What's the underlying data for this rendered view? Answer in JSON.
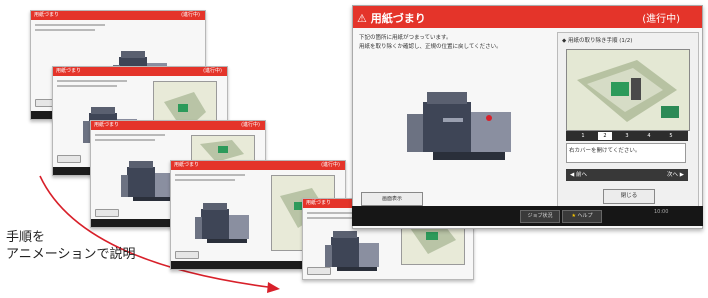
{
  "screens": {
    "title": "用紙づまり",
    "status_label": "(進行中)",
    "message_lines": [
      "下記の箇所に用紙がつまっています。",
      "用紙を取り除くか確認し、正規の位置に戻してください。"
    ],
    "step_panel_title": "◆ 用紙の取り除き手順 (1/2)",
    "step_numbers": [
      "1",
      "2",
      "3",
      "4",
      "5"
    ],
    "instruction": "右カバーを開けてください。",
    "nav_prev": "◀ 前へ",
    "nav_next": "次へ ▶",
    "close_label": "閉じる",
    "left_button_label": "画面表示",
    "bottom_button_1": "ジョブ状況",
    "bottom_button_2": "ヘルプ",
    "status_text": "10:00"
  },
  "caption": {
    "line1": "手順を",
    "line2": "アニメーションで説明"
  },
  "colors": {
    "title_bar": "#e4342a",
    "arrow": "#d8202a",
    "bottom_bar": "#161616"
  },
  "icons": [
    "copier-icon",
    "paper-path-icon",
    "arrow-icon"
  ]
}
